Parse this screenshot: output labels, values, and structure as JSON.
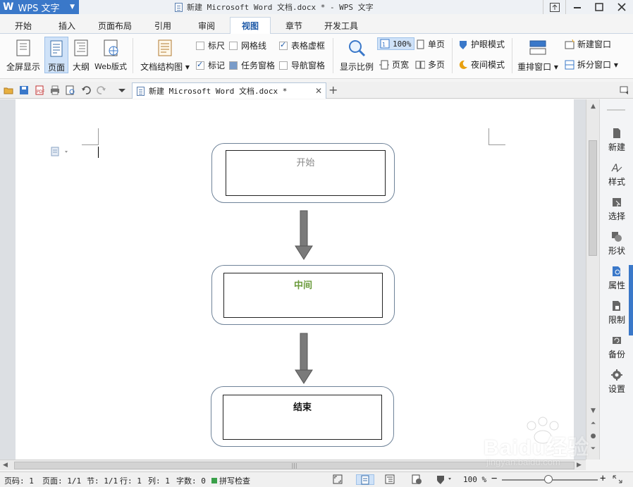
{
  "app": {
    "name": "WPS 文字",
    "window_title": "新建 Microsoft Word 文档.docx * - WPS 文字"
  },
  "menu": {
    "tabs": [
      "开始",
      "插入",
      "页面布局",
      "引用",
      "审阅",
      "视图",
      "章节",
      "开发工具"
    ],
    "active_tab": "视图"
  },
  "ribbon": {
    "fullscreen": "全屏显示",
    "page": "页面",
    "outline": "大纲",
    "web_layout": "Web版式",
    "doc_structure": "文档结构图",
    "ruler": "标尺",
    "gridlines": "网格线",
    "table_gridlines": "表格虚框",
    "marks": "标记",
    "task_pane": "任务窗格",
    "nav_pane": "导航窗格",
    "zoom_ratio": "显示比例",
    "zoom_100": "100%",
    "page_width": "页宽",
    "single_page": "单页",
    "multi_page": "多页",
    "eye_mode": "护眼模式",
    "night_mode": "夜间模式",
    "arrange_windows": "重排窗口",
    "new_window": "新建窗口",
    "split_window": "拆分窗口",
    "checkbox_state": {
      "ruler": false,
      "gridlines": false,
      "table_gridlines": true,
      "marks": true,
      "task_pane": true,
      "nav_pane": false
    }
  },
  "document_tab": {
    "title": "新建 Microsoft Word 文档.docx *"
  },
  "flowchart": {
    "nodes": [
      "开始",
      "中间",
      "结束"
    ],
    "node_colors": [
      "#888888",
      "#6a9a3a",
      "#111111"
    ]
  },
  "side_panel": {
    "items": [
      "新建",
      "样式",
      "选择",
      "形状",
      "属性",
      "限制",
      "备份",
      "设置"
    ]
  },
  "status": {
    "page_code": "页码: 1",
    "pages": "页面: 1/1",
    "section": "节: 1/1",
    "line": "行: 1",
    "column": "列: 1",
    "word_count": "字数: 0",
    "spell_check": "拼写检查",
    "zoom": "100 %"
  },
  "watermark": {
    "brand": "Baidu经验",
    "url": "jingyan.baidu.com"
  },
  "colors": {
    "accent": "#3a78c9",
    "active_tab_text": "#1e5aa8",
    "node_border": "#6f8399",
    "arrow": "#7a7a7a"
  }
}
